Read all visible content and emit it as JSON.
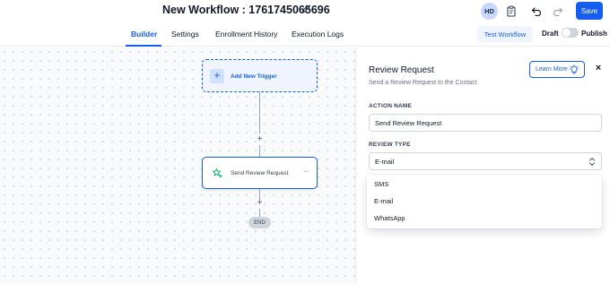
{
  "header": {
    "workflow_title": "New Workflow : 1761745065696",
    "avatar_initials": "HD",
    "save_label": "Save",
    "brand_color": "#155eef"
  },
  "tabs": [
    {
      "label": "Builder",
      "active": true
    },
    {
      "label": "Settings",
      "active": false
    },
    {
      "label": "Enrollment History",
      "active": false
    },
    {
      "label": "Execution Logs",
      "active": false
    }
  ],
  "toolbar": {
    "test_workflow_label": "Test Workflow",
    "draft_label": "Draft",
    "publish_label": "Publish",
    "publish_enabled": false
  },
  "canvas": {
    "trigger": {
      "plus": "+",
      "label": "Add New Trigger"
    },
    "connector_plus": "+",
    "action": {
      "label": "Send Review Request",
      "icon": "star-send-icon",
      "menu": "···"
    },
    "end_label": "END"
  },
  "panel": {
    "title": "Review Request",
    "subtitle": "Send a Review Request to the Contact",
    "learn_more_label": "Learn More",
    "close": "×",
    "action_name_label": "ACTION NAME",
    "action_name_value": "Send Review Request",
    "review_type_label": "REVIEW TYPE",
    "review_type_value": "E-mail",
    "review_type_options": [
      "SMS",
      "E-mail",
      "WhatsApp"
    ]
  }
}
